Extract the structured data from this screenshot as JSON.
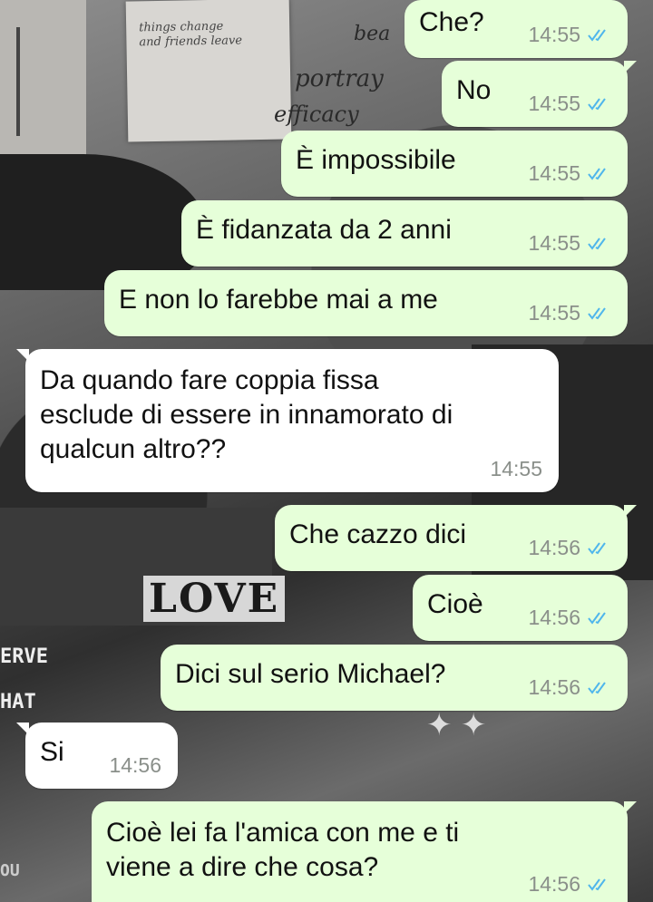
{
  "wallpaper": {
    "note_text": "things change\nand friends leave",
    "cursive_words": [
      "portray",
      "efficacy",
      "bea"
    ],
    "love_word": "LOVE",
    "stamp_words": [
      "ERVE",
      "HAT",
      "OU"
    ]
  },
  "colors": {
    "outgoing_bubble": "#e6ffd9",
    "incoming_bubble": "#ffffff",
    "read_ticks": "#4fb6ec",
    "timestamp": "#8a8f8a"
  },
  "messages": [
    {
      "direction": "out",
      "text": "Che?",
      "time": "14:55",
      "status": "read"
    },
    {
      "direction": "out",
      "text": "No",
      "time": "14:55",
      "status": "read"
    },
    {
      "direction": "out",
      "text": "È impossibile",
      "time": "14:55",
      "status": "read"
    },
    {
      "direction": "out",
      "text": "È fidanzata da 2 anni",
      "time": "14:55",
      "status": "read"
    },
    {
      "direction": "out",
      "text": "E non lo farebbe mai a me",
      "time": "14:55",
      "status": "read"
    },
    {
      "direction": "in",
      "text": "Da quando fare coppia fissa\nesclude di essere in innamorato di\nqualcun altro??",
      "time": "14:55"
    },
    {
      "direction": "out",
      "text": "Che cazzo dici",
      "time": "14:56",
      "status": "read"
    },
    {
      "direction": "out",
      "text": "Cioè",
      "time": "14:56",
      "status": "read"
    },
    {
      "direction": "out",
      "text": "Dici sul serio Michael?",
      "time": "14:56",
      "status": "read"
    },
    {
      "direction": "in",
      "text": "Si",
      "time": "14:56"
    },
    {
      "direction": "out",
      "text": "Cioè lei fa l'amica con me e ti\nviene a dire che cosa?",
      "time": "14:56",
      "status": "read"
    }
  ]
}
